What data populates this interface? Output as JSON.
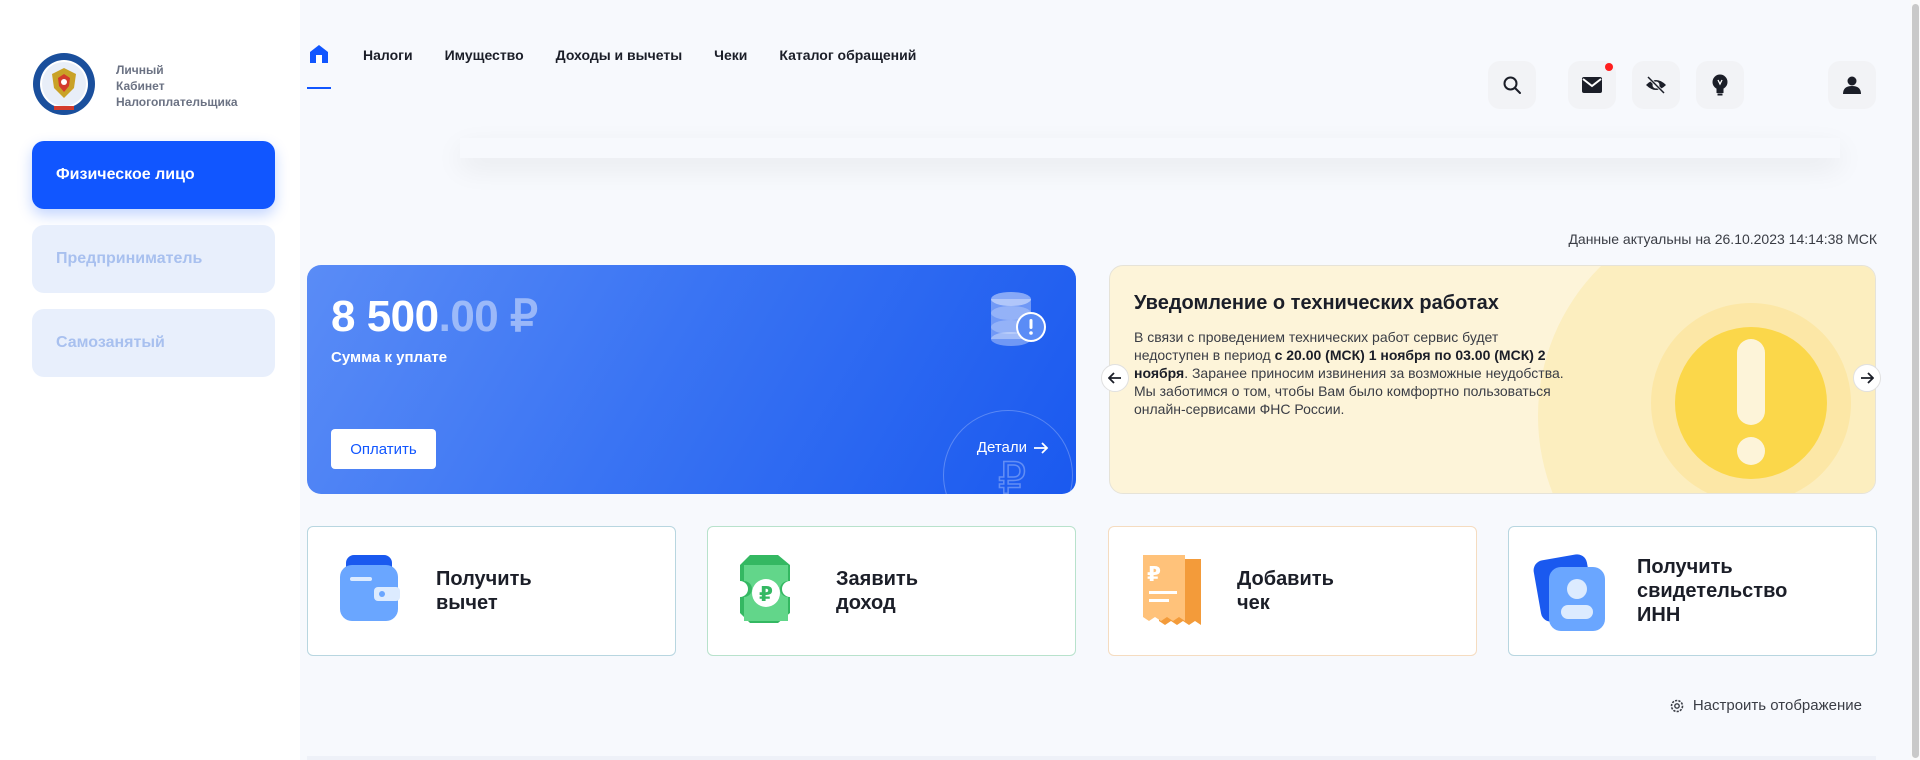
{
  "logo": {
    "line1": "Личный",
    "line2": "Кабинет",
    "line3": "Налогоплательщика",
    "emblem_icon": "fns-emblem-icon"
  },
  "sidebar": {
    "items": [
      {
        "label": "Физическое лицо",
        "active": true
      },
      {
        "label": "Предприниматель",
        "active": false
      },
      {
        "label": "Самозанятый",
        "active": false
      }
    ]
  },
  "nav": {
    "home_icon": "home-icon",
    "items": [
      "Налоги",
      "Имущество",
      "Доходы и вычеты",
      "Чеки",
      "Каталог обращений"
    ]
  },
  "header_icons": {
    "search": "search-icon",
    "mail": "mail-icon",
    "hide": "eye-off-icon",
    "tips": "lightbulb-icon",
    "profile": "user-icon"
  },
  "status": {
    "actual": "Данные актуальны на 26.10.2023 14:14:38 МСК"
  },
  "payment": {
    "amount_int": "8 500",
    "amount_cents": ".00 ₽",
    "label": "Сумма к уплате",
    "pay_button": "Оплатить",
    "details": "Детали"
  },
  "notice": {
    "title": "Уведомление о технических работах",
    "text_1": "В связи с проведением технических работ сервис будет недоступен в период ",
    "text_bold": "с 20.00 (МСК) 1 ноября по 03.00 (МСК) 2 ноября",
    "text_2": ". Заранее приносим извинения за возможные неудобства. Мы заботимся о том, чтобы Вам было комфортно пользоваться онлайн-сервисами ФНС России."
  },
  "actions": [
    {
      "line1": "Получить",
      "line2": "вычет",
      "line3": "",
      "icon": "wallet-icon"
    },
    {
      "line1": "Заявить",
      "line2": "доход",
      "line3": "",
      "icon": "ruble-ticket-icon"
    },
    {
      "line1": "Добавить",
      "line2": "чек",
      "line3": "",
      "icon": "receipt-icon"
    },
    {
      "line1": "Получить",
      "line2": "свидетельство",
      "line3": "ИНН",
      "icon": "id-card-icon"
    }
  ],
  "customize": {
    "label": "Настроить отображение",
    "icon": "gear-icon"
  },
  "colors": {
    "accent": "#1156ff",
    "notice_bg": "#fdf4d9",
    "warning": "#fbd74a"
  }
}
